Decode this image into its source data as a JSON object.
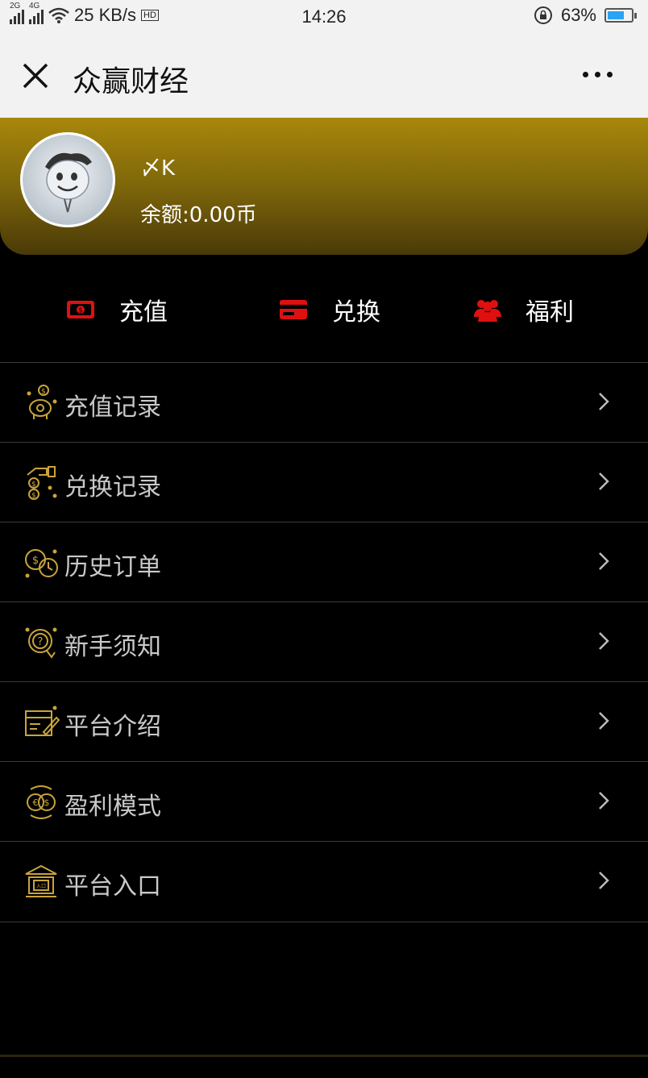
{
  "status_bar": {
    "signal1": "2G",
    "signal2": "4G",
    "speed": "25 KB/s",
    "hd": "HD",
    "time": "14:26",
    "battery": "63%",
    "battery_level": 0.63
  },
  "header": {
    "title": "众赢财经"
  },
  "profile": {
    "username": "〆K",
    "balance": "余额:0.00币"
  },
  "actions": [
    {
      "label": "充值",
      "icon": "money-icon"
    },
    {
      "label": "兑换",
      "icon": "card-icon"
    },
    {
      "label": "福利",
      "icon": "users-icon"
    }
  ],
  "menu": [
    {
      "label": "充值记录",
      "icon": "piggy-bank-icon"
    },
    {
      "label": "兑换记录",
      "icon": "hand-coins-icon"
    },
    {
      "label": "历史订单",
      "icon": "coin-clock-icon"
    },
    {
      "label": "新手须知",
      "icon": "question-badge-icon"
    },
    {
      "label": "平台介绍",
      "icon": "document-pen-icon"
    },
    {
      "label": "盈利模式",
      "icon": "currency-exchange-icon"
    },
    {
      "label": "平台入口",
      "icon": "bank-building-icon"
    }
  ],
  "colors": {
    "accent_gold": "#c9a43a",
    "action_red": "#e01010",
    "banner_gold": "#a8870b"
  }
}
